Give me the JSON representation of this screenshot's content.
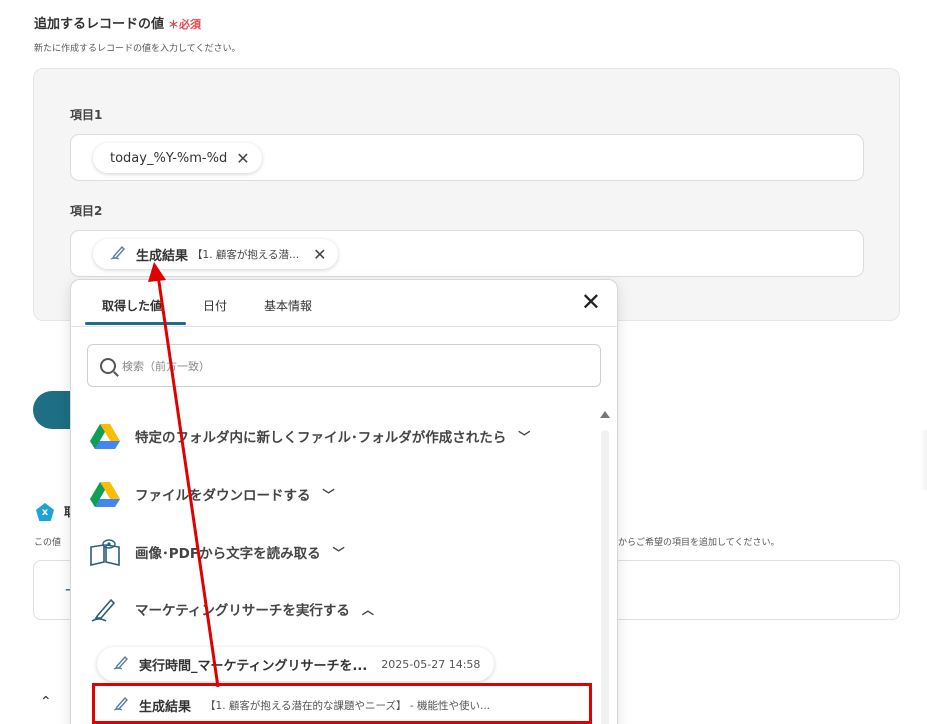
{
  "section": {
    "title": "追加するレコードの値",
    "required": "＊必須",
    "description": "新たに作成するレコードの値を入力してください。"
  },
  "fields": [
    {
      "label": "項目1",
      "chip": {
        "text": "today_%Y-%m-%d"
      }
    },
    {
      "label": "項目2",
      "chip": {
        "name": "生成結果",
        "preview": "【1. 顧客が抱える潜..."
      }
    }
  ],
  "background": {
    "partial_label": "取",
    "desc_left": "この値",
    "desc_right": "からご希望の項目を追加してください。",
    "badge_letter": "x"
  },
  "popup": {
    "tabs": [
      "取得した値",
      "日付",
      "基本情報"
    ],
    "active_tab": 0,
    "search_placeholder": "検索（前方一致）",
    "sections": [
      {
        "label": "特定のフォルダ内に新しくファイル･フォルダが作成されたら",
        "icon": "google-drive-icon",
        "expanded": false
      },
      {
        "label": "ファイルをダウンロードする",
        "icon": "google-drive-icon",
        "expanded": false
      },
      {
        "label": "画像･PDFから文字を読み取る",
        "icon": "book-ocr-icon",
        "expanded": false
      },
      {
        "label": "マーケティングリサーチを実行する",
        "icon": "pen-icon",
        "expanded": true
      }
    ],
    "results": [
      {
        "name": "実行時間_マーケティングリサーチを...",
        "value": "2025-05-27 14:58"
      },
      {
        "name": "生成結果",
        "value": "【1. 顧客が抱える潜在的な課題やニーズ】 - 機能性や使い..."
      }
    ]
  },
  "colors": {
    "accent": "#1e6e84",
    "required": "#e5484d",
    "annotation": "#e00000"
  }
}
